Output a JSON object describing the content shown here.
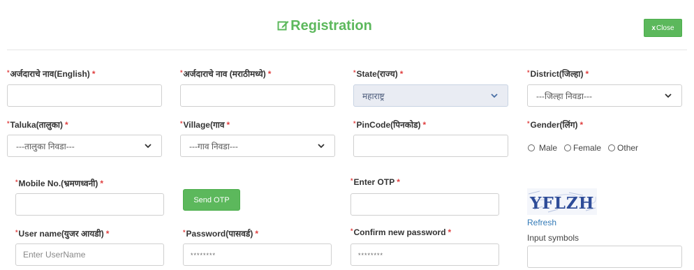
{
  "header": {
    "title": "Registration",
    "close_label": "Close",
    "close_x": "x"
  },
  "colors": {
    "primary_green": "#5cb85c",
    "required_red": "#e04040",
    "link_blue": "#337ab7"
  },
  "form": {
    "applicant_name_en": {
      "label": "अर्जदाराचे नाव(English)",
      "value": ""
    },
    "applicant_name_mr": {
      "label": "अर्जदाराचे नाव (मराठीमध्ये)",
      "value": ""
    },
    "state": {
      "label": "State(राज्य)",
      "selected": "महाराष्ट्र"
    },
    "district": {
      "label": "District(जिल्हा)",
      "selected": "---जिल्हा निवडा---"
    },
    "taluka": {
      "label": "Taluka(तालुका)",
      "selected": "---तालुका निवडा---"
    },
    "village": {
      "label": "Village(गाव",
      "selected": "---गाव निवडा---"
    },
    "pincode": {
      "label": "PinCode(पिनकोड)",
      "value": ""
    },
    "gender": {
      "label": "Gender(लिंग)",
      "options": [
        "Male",
        "Female",
        "Other"
      ]
    },
    "mobile": {
      "label": "Mobile No.(भ्रमणध्वनी)",
      "value": ""
    },
    "send_otp_label": "Send OTP",
    "otp": {
      "label": "Enter OTP",
      "value": ""
    },
    "username": {
      "label": "User name(युजर आयडी)",
      "placeholder": "Enter UserName"
    },
    "password": {
      "label": "Password(पासवर्ड)",
      "placeholder": "********"
    },
    "confirm_password": {
      "label": "Confirm new password",
      "placeholder": "********"
    },
    "captcha": {
      "text": "YFLZH",
      "refresh_label": "Refresh",
      "input_label": "Input symbols",
      "value": ""
    }
  },
  "required_marker": "*",
  "icons": {
    "title_icon": "edit-icon",
    "select_icon": "chevron-down-icon"
  }
}
